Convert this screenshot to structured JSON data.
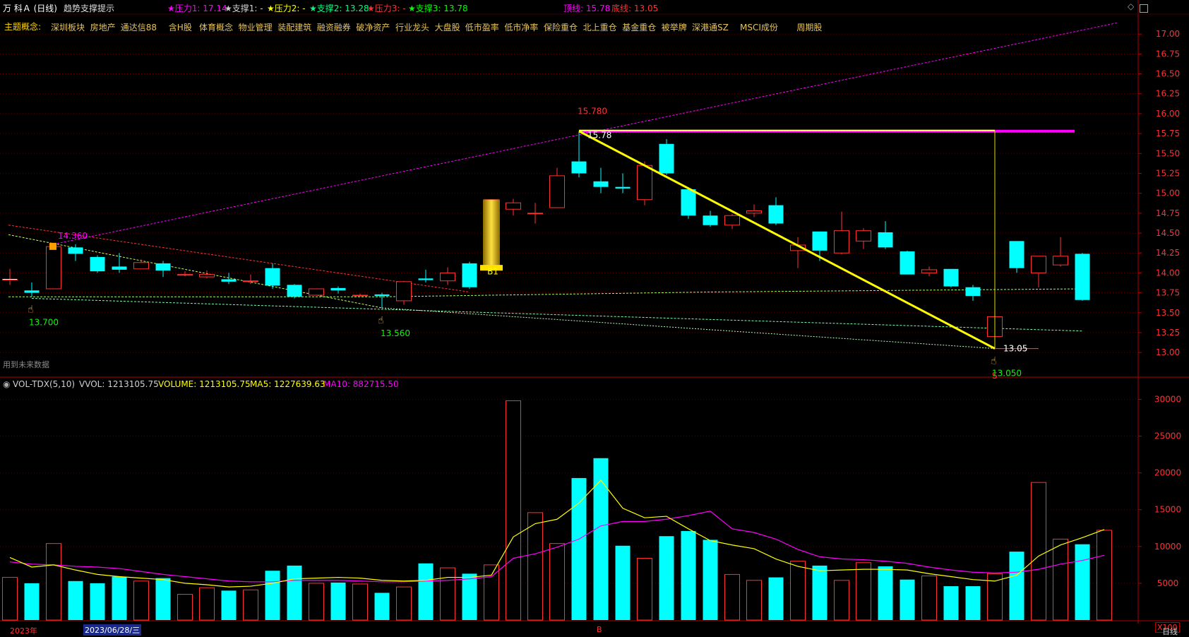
{
  "header": {
    "stock": "万 科Ａ (日线)",
    "indicator": "趋势支撑提示",
    "p1": "★压力1: 17.14",
    "s1": "★支撑1: -",
    "p2": "★压力2: -",
    "s2": "★支撑2: 13.28",
    "p3": "★压力3: -",
    "s3": "★支撑3: 13.78",
    "top_line": "顶线: 15.78",
    "bottom_line": "底线: 13.05"
  },
  "concepts": {
    "label": "主题概念:",
    "items": [
      "深圳板块",
      "房地产",
      "通达信88",
      "含H股",
      "体育概念",
      "物业管理",
      "装配建筑",
      "融资融券",
      "破净资产",
      "行业龙头",
      "大盘股",
      "低市盈率",
      "低市净率",
      "保险重仓",
      "北上重仓",
      "基金重仓",
      "被举牌",
      "深港通SZ",
      "MSCI成份",
      "周期股"
    ]
  },
  "volume_header": {
    "name": "VOL-TDX(5,10)",
    "vvol": "VVOL: 1213105.75",
    "volume": "VOLUME: 1213105.75",
    "ma5": "MA5: 1227639.63",
    "ma10": "MA10: 882715.50"
  },
  "note": "用到未来数据",
  "bottom": {
    "year": "2023年",
    "date": "2023/06/28/三",
    "marker": "B",
    "x100": "X100",
    "period": "日线"
  },
  "colors": {
    "up": "#ff3232",
    "down": "#00ffff",
    "pink": "#ff00ff",
    "yellow": "#ffff00",
    "green": "#00ff00",
    "axis": "#b40000"
  },
  "chart_data": [
    {
      "type": "candlestick",
      "title": "",
      "ylim": [
        12.7,
        17.25
      ],
      "y_ticks": [
        "13.00",
        "13.25",
        "13.50",
        "13.75",
        "14.00",
        "14.25",
        "14.50",
        "14.75",
        "15.00",
        "15.25",
        "15.50",
        "15.75",
        "16.00",
        "16.25",
        "16.50",
        "16.75",
        "17.00"
      ],
      "candles": [
        {
          "o": 13.92,
          "h": 14.05,
          "l": 13.85,
          "c": 13.92
        },
        {
          "o": 13.78,
          "h": 13.88,
          "l": 13.7,
          "c": 13.75
        },
        {
          "o": 13.8,
          "h": 14.36,
          "l": 13.8,
          "c": 14.33
        },
        {
          "o": 14.32,
          "h": 14.36,
          "l": 14.15,
          "c": 14.24
        },
        {
          "o": 14.2,
          "h": 14.22,
          "l": 14.0,
          "c": 14.02
        },
        {
          "o": 14.08,
          "h": 14.25,
          "l": 14.0,
          "c": 14.04
        },
        {
          "o": 14.05,
          "h": 14.17,
          "l": 14.05,
          "c": 14.13
        },
        {
          "o": 14.12,
          "h": 14.15,
          "l": 13.95,
          "c": 14.03
        },
        {
          "o": 13.98,
          "h": 14.02,
          "l": 13.96,
          "c": 13.98
        },
        {
          "o": 13.95,
          "h": 14.03,
          "l": 13.93,
          "c": 13.98
        },
        {
          "o": 13.92,
          "h": 14.0,
          "l": 13.86,
          "c": 13.89
        },
        {
          "o": 13.9,
          "h": 13.98,
          "l": 13.86,
          "c": 13.9
        },
        {
          "o": 14.06,
          "h": 14.12,
          "l": 13.8,
          "c": 13.84
        },
        {
          "o": 13.85,
          "h": 13.86,
          "l": 13.68,
          "c": 13.7
        },
        {
          "o": 13.72,
          "h": 13.8,
          "l": 13.72,
          "c": 13.8
        },
        {
          "o": 13.81,
          "h": 13.83,
          "l": 13.74,
          "c": 13.78
        },
        {
          "o": 13.72,
          "h": 13.74,
          "l": 13.7,
          "c": 13.72
        },
        {
          "o": 13.73,
          "h": 13.75,
          "l": 13.56,
          "c": 13.71
        },
        {
          "o": 13.65,
          "h": 13.9,
          "l": 13.6,
          "c": 13.89
        },
        {
          "o": 13.93,
          "h": 14.04,
          "l": 13.88,
          "c": 13.91
        },
        {
          "o": 13.9,
          "h": 14.07,
          "l": 13.85,
          "c": 14.0
        },
        {
          "o": 14.12,
          "h": 14.14,
          "l": 13.8,
          "c": 13.82
        },
        {
          "o": 14.08,
          "h": 14.92,
          "l": 14.08,
          "c": 14.92
        },
        {
          "o": 14.8,
          "h": 14.93,
          "l": 14.72,
          "c": 14.88
        },
        {
          "o": 14.75,
          "h": 14.88,
          "l": 14.62,
          "c": 14.75
        },
        {
          "o": 14.82,
          "h": 15.32,
          "l": 14.82,
          "c": 15.22
        },
        {
          "o": 15.4,
          "h": 15.78,
          "l": 15.2,
          "c": 15.25
        },
        {
          "o": 15.15,
          "h": 15.32,
          "l": 15.0,
          "c": 15.08
        },
        {
          "o": 15.08,
          "h": 15.25,
          "l": 15.0,
          "c": 15.06
        },
        {
          "o": 14.92,
          "h": 15.4,
          "l": 14.85,
          "c": 15.35
        },
        {
          "o": 15.62,
          "h": 15.68,
          "l": 15.23,
          "c": 15.25
        },
        {
          "o": 15.05,
          "h": 15.05,
          "l": 14.68,
          "c": 14.72
        },
        {
          "o": 14.72,
          "h": 14.78,
          "l": 14.58,
          "c": 14.6
        },
        {
          "o": 14.6,
          "h": 14.74,
          "l": 14.55,
          "c": 14.72
        },
        {
          "o": 14.75,
          "h": 14.86,
          "l": 14.7,
          "c": 14.78
        },
        {
          "o": 14.85,
          "h": 14.95,
          "l": 14.6,
          "c": 14.62
        },
        {
          "o": 14.28,
          "h": 14.45,
          "l": 14.06,
          "c": 14.35
        },
        {
          "o": 14.52,
          "h": 14.52,
          "l": 14.15,
          "c": 14.28
        },
        {
          "o": 14.25,
          "h": 14.77,
          "l": 14.23,
          "c": 14.53
        },
        {
          "o": 14.4,
          "h": 14.56,
          "l": 14.3,
          "c": 14.53
        },
        {
          "o": 14.51,
          "h": 14.65,
          "l": 14.3,
          "c": 14.32
        },
        {
          "o": 14.27,
          "h": 14.28,
          "l": 13.98,
          "c": 13.98
        },
        {
          "o": 14.0,
          "h": 14.08,
          "l": 13.96,
          "c": 14.04
        },
        {
          "o": 14.05,
          "h": 14.05,
          "l": 13.82,
          "c": 13.83
        },
        {
          "o": 13.82,
          "h": 13.85,
          "l": 13.65,
          "c": 13.71
        },
        {
          "o": 13.2,
          "h": 13.45,
          "l": 13.05,
          "c": 13.45
        },
        {
          "o": 14.4,
          "h": 14.4,
          "l": 14.0,
          "c": 14.06
        },
        {
          "o": 14.0,
          "h": 14.2,
          "l": 13.82,
          "c": 14.21
        },
        {
          "o": 14.1,
          "h": 14.45,
          "l": 14.08,
          "c": 14.21
        },
        {
          "o": 14.24,
          "h": 14.25,
          "l": 13.65,
          "c": 13.66
        }
      ],
      "labels": [
        {
          "text": "14.360",
          "i": 2,
          "y": 14.36,
          "color": "#ff00ff"
        },
        {
          "text": "13.700",
          "i": 1,
          "y": 13.7,
          "color": "#00ff00"
        },
        {
          "text": "13.560",
          "i": 17,
          "y": 13.56,
          "color": "#00ff00"
        },
        {
          "text": "15.780",
          "i": 26,
          "y": 15.78,
          "color": "#ff3232"
        },
        {
          "text": "15.78",
          "i": 26,
          "y": 15.78,
          "color": "#ffffff"
        },
        {
          "text": "13.05",
          "i": 45,
          "y": 13.05,
          "color": "#ffffff"
        },
        {
          "text": "13.050",
          "i": 45,
          "y": 13.05,
          "color": "#00ff00"
        },
        {
          "text": "B1",
          "i": 22,
          "y": 14.0,
          "color": "#ffff00"
        },
        {
          "text": "S",
          "i": 45,
          "y": 12.75,
          "color": "#ff3232"
        }
      ]
    },
    {
      "type": "bar",
      "title": "",
      "ylim": [
        0,
        31000
      ],
      "y_ticks": [
        "5000",
        "10000",
        "15000",
        "20000",
        "25000",
        "30000"
      ],
      "values": [
        5800,
        5000,
        10400,
        5300,
        5000,
        5900,
        5300,
        5700,
        3500,
        4400,
        4000,
        4100,
        6700,
        7400,
        5000,
        5100,
        4900,
        3700,
        4500,
        7700,
        7100,
        6300,
        7500,
        29800,
        14600,
        10400,
        19300,
        22000,
        10100,
        8400,
        11400,
        12100,
        10900,
        6200,
        5400,
        5800,
        8000,
        7400,
        5400,
        7800,
        7300,
        5500,
        6000,
        4600,
        4600,
        6300,
        9300,
        18700,
        11000,
        10300,
        12200
      ],
      "ma5": [
        8500,
        7200,
        7500,
        6800,
        6200,
        5900,
        5700,
        5500,
        5000,
        4800,
        4500,
        4600,
        5000,
        5600,
        5700,
        5800,
        5700,
        5400,
        5300,
        5400,
        5800,
        5800,
        6100,
        11300,
        13100,
        13700,
        15900,
        19000,
        15200,
        13900,
        14100,
        12400,
        10800,
        10200,
        9700,
        8300,
        7300,
        6700,
        6800,
        6900,
        6900,
        6800,
        6300,
        5900,
        5500,
        5300,
        6100,
        8700,
        10200,
        11200,
        12300
      ],
      "ma10": [
        7900,
        7600,
        7500,
        7300,
        7200,
        7000,
        6600,
        6200,
        5900,
        5600,
        5300,
        5200,
        5200,
        5400,
        5400,
        5400,
        5300,
        5200,
        5200,
        5300,
        5400,
        5600,
        5900,
        8400,
        9000,
        9900,
        11000,
        12800,
        13400,
        13400,
        13700,
        14200,
        14800,
        12400,
        11900,
        11000,
        9600,
        8600,
        8300,
        8200,
        8000,
        7700,
        7200,
        6800,
        6500,
        6400,
        6500,
        6900,
        7600,
        8100,
        8800
      ]
    }
  ]
}
